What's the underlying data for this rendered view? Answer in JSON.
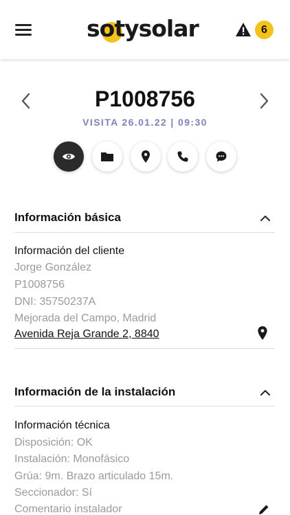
{
  "header": {
    "brand": "sotysolar",
    "alert_count": "6"
  },
  "visit": {
    "code": "P1008756",
    "subtitle": "VISITA  26.01.22  |  09:30"
  },
  "actions": [
    "eye-icon",
    "folder-icon",
    "location-pin-icon",
    "phone-icon",
    "chat-icon"
  ],
  "basic_info": {
    "title": "Información básica",
    "subheading": "Información del cliente",
    "client_name": "Jorge González",
    "client_code": "P1008756",
    "dni": "DNI: 35750237A",
    "city": "Mejorada del Campo, Madrid",
    "address": "Avenida Reja Grande 2, 8840"
  },
  "installation_info": {
    "title": "Información de la instalación",
    "subheading": "Información técnica",
    "disposition": "Disposición: OK",
    "installation": "Instalación: Monofásico",
    "crane": "Grúa: 9m. Brazo articulado 15m.",
    "disconnector": "Seccionador: Sí",
    "comment": "Comentario instalador"
  },
  "colors": {
    "brand_yellow": "#f5c21b",
    "subtitle_blue": "#7b84b8",
    "active_dark": "#2b2b2b"
  }
}
